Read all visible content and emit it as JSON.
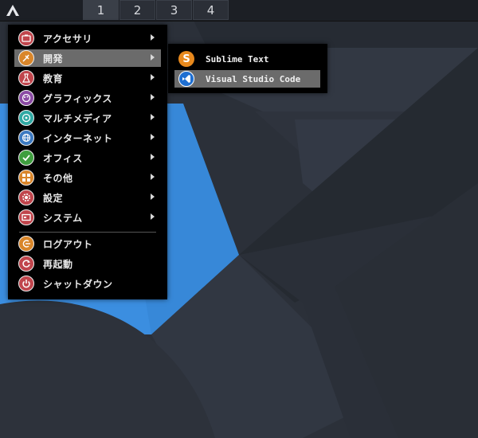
{
  "panel": {
    "workspaces": [
      "1",
      "2",
      "3",
      "4"
    ],
    "active_workspace": "1"
  },
  "menu": {
    "items": [
      {
        "label": "アクセサリ",
        "icon": "accessories-icon",
        "color": "#c0454c",
        "submenu": true
      },
      {
        "label": "開発",
        "icon": "development-icon",
        "color": "#d9862a",
        "submenu": true,
        "highlighted": true
      },
      {
        "label": "教育",
        "icon": "education-icon",
        "color": "#c0454c",
        "submenu": true
      },
      {
        "label": "グラフィックス",
        "icon": "graphics-icon",
        "color": "#8b4ba4",
        "submenu": true
      },
      {
        "label": "マルチメディア",
        "icon": "multimedia-icon",
        "color": "#2fa9a3",
        "submenu": true
      },
      {
        "label": "インターネット",
        "icon": "internet-icon",
        "color": "#3b79c1",
        "submenu": true
      },
      {
        "label": "オフィス",
        "icon": "office-icon",
        "color": "#3f9e3f",
        "submenu": true
      },
      {
        "label": "その他",
        "icon": "other-icon",
        "color": "#d9862a",
        "submenu": true
      },
      {
        "label": "設定",
        "icon": "settings-icon",
        "color": "#c0454c",
        "submenu": true
      },
      {
        "label": "システム",
        "icon": "system-icon",
        "color": "#c0454c",
        "submenu": true
      }
    ],
    "session": [
      {
        "label": "ログアウト",
        "icon": "logout-icon",
        "color": "#d9862a"
      },
      {
        "label": "再起動",
        "icon": "reboot-icon",
        "color": "#c0454c"
      },
      {
        "label": "シャットダウン",
        "icon": "shutdown-icon",
        "color": "#c0454c"
      }
    ]
  },
  "submenu": {
    "items": [
      {
        "label": "Sublime Text",
        "icon": "sublime-text-icon",
        "color": "#e8891d",
        "glyph": "S"
      },
      {
        "label": "Visual Studio Code",
        "icon": "vscode-icon",
        "color": "#1f6fd1",
        "highlighted": true
      }
    ]
  }
}
